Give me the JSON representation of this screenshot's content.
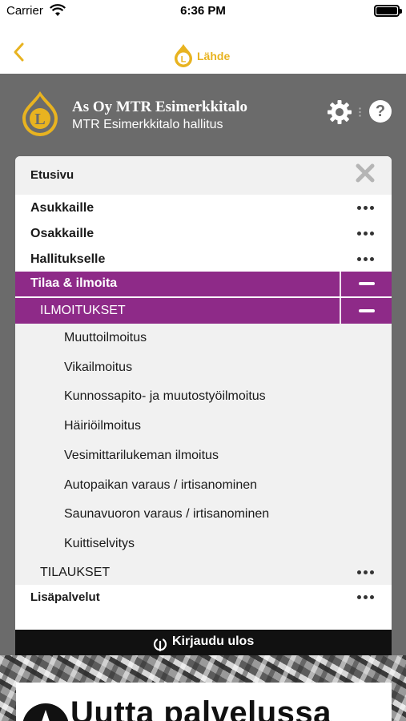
{
  "status_bar": {
    "carrier": "Carrier",
    "time": "6:36 PM"
  },
  "nav": {
    "logo_text": "Lähde",
    "brand_color": "#e8b320"
  },
  "header": {
    "title": "As Oy MTR Esimerkkitalo",
    "subtitle": "MTR Esimerkkitalo hallitus",
    "help_symbol": "?",
    "background": "#6b6b6b"
  },
  "menu": {
    "home_label": "Etusivu",
    "items": [
      {
        "label": "Asukkaille"
      },
      {
        "label": "Osakkaille"
      },
      {
        "label": "Hallitukselle"
      }
    ],
    "active_section": {
      "label": "Tilaa & ilmoita",
      "color": "#8e2a88"
    },
    "active_subsection": {
      "label": "ILMOITUKSET"
    },
    "sub_items": [
      {
        "label": "Muuttoilmoitus"
      },
      {
        "label": "Vikailmoitus"
      },
      {
        "label": "Kunnossapito- ja muutostyöilmoitus"
      },
      {
        "label": "Häiriöilmoitus"
      },
      {
        "label": "Vesimittarilukeman ilmoitus"
      },
      {
        "label": "Autopaikan varaus / irtisanominen"
      },
      {
        "label": "Saunavuoron varaus / irtisanominen"
      },
      {
        "label": "Kuittiselvitys"
      }
    ],
    "orders_label": "TILAUKSET",
    "extra_label": "Lisäpalvelut"
  },
  "logout": {
    "label": "Kirjaudu ulos"
  },
  "promo": {
    "text": "Uutta palvelussa"
  }
}
